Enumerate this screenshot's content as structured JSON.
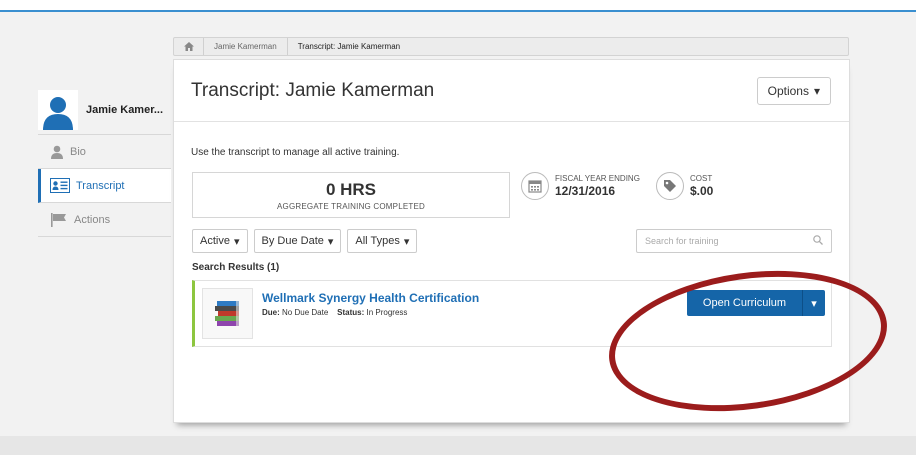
{
  "breadcrumb": {
    "items": [
      "Jamie Kamerman",
      "Transcript: Jamie Kamerman"
    ]
  },
  "sidebar": {
    "profile_name": "Jamie Kamer...",
    "items": [
      {
        "label": "Bio",
        "icon": "person-icon"
      },
      {
        "label": "Transcript",
        "icon": "transcript-icon",
        "active": true
      },
      {
        "label": "Actions",
        "icon": "flag-icon"
      }
    ]
  },
  "main": {
    "title": "Transcript: Jamie Kamerman",
    "options_label": "Options",
    "subtitle": "Use the transcript to manage all active training.",
    "hours_value": "0 HRS",
    "hours_caption": "AGGREGATE TRAINING COMPLETED",
    "fiscal_label": "FISCAL YEAR ENDING",
    "fiscal_value": "12/31/2016",
    "cost_label": "COST",
    "cost_value": "$.00",
    "filters": [
      "Active",
      "By Due Date",
      "All Types"
    ],
    "search_placeholder": "Search for training",
    "results_label": "Search Results (1)"
  },
  "result": {
    "title": "Wellmark Synergy Health Certification",
    "due_label": "Due:",
    "due_value": "No Due Date",
    "status_label": "Status:",
    "status_value": "In Progress",
    "button_label": "Open Curriculum"
  },
  "colors": {
    "accent": "#1565a8",
    "link": "#1f6fb5",
    "row_accent": "#8dc63f",
    "annotation": "#9b1c1c"
  }
}
